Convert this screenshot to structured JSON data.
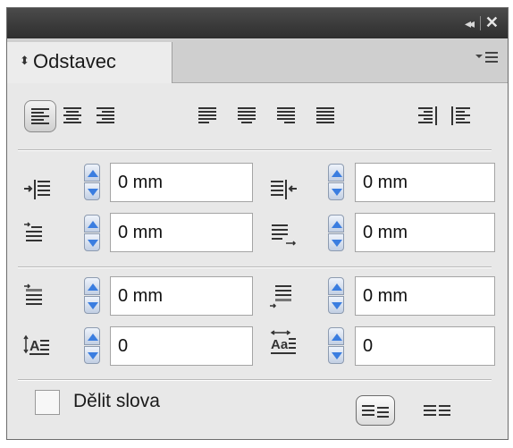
{
  "panel": {
    "tab_label": "Odstavec",
    "tab_arrow": "⬍"
  },
  "titlebar": {
    "collapse_glyph": "◂◂",
    "close_glyph": "✕"
  },
  "alignment_buttons": [
    {
      "name": "align-left",
      "selected": true
    },
    {
      "name": "align-center",
      "selected": false
    },
    {
      "name": "align-right",
      "selected": false
    },
    {
      "name": "justify-left",
      "selected": false
    },
    {
      "name": "justify-center",
      "selected": false
    },
    {
      "name": "justify-right",
      "selected": false
    },
    {
      "name": "justify-all",
      "selected": false
    },
    {
      "name": "align-towards-spine",
      "selected": false
    },
    {
      "name": "align-away-from-spine",
      "selected": false
    }
  ],
  "fields": {
    "left_indent": "0 mm",
    "right_indent": "0 mm",
    "first_line_indent": "0 mm",
    "last_line_indent": "0 mm",
    "space_before": "0 mm",
    "space_after": "0 mm",
    "drop_cap_lines": "0",
    "drop_cap_chars": "0"
  },
  "hyphenate": {
    "label": "Dělit slova",
    "checked": false
  },
  "grid_align": {
    "selected": "do-not-align"
  }
}
